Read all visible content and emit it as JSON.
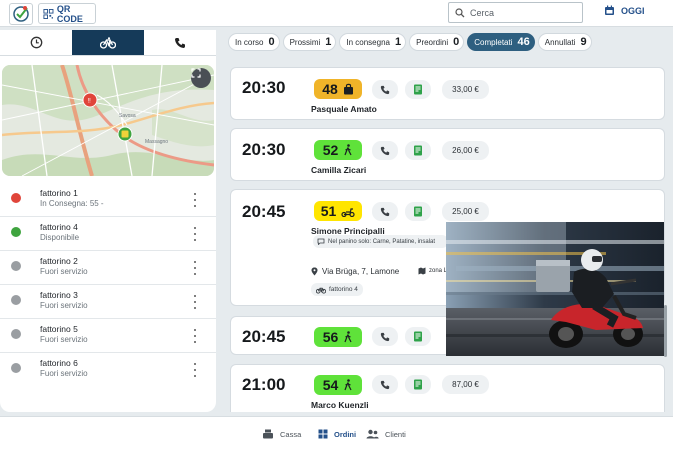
{
  "header": {
    "qr_label": "QR CODE",
    "search_placeholder": "Cerca",
    "today_label": "OGGI",
    "icons": [
      "app-logo-icon",
      "qr-icon",
      "search-icon",
      "calendar-icon"
    ]
  },
  "left_tabs": [
    {
      "icon": "clock-icon",
      "active": false
    },
    {
      "icon": "bicycle-icon",
      "active": true
    },
    {
      "icon": "phone-icon",
      "active": false
    }
  ],
  "couriers": [
    {
      "name": "fattorino 1",
      "status": "In Consegna: 55 -",
      "color": "#e0453a"
    },
    {
      "name": "fattorino 4",
      "status": "Disponibile",
      "color": "#3fa43f"
    },
    {
      "name": "fattorino 2",
      "status": "Fuori servizio",
      "color": "#9a9ea2"
    },
    {
      "name": "fattorino 3",
      "status": "Fuori servizio",
      "color": "#9a9ea2"
    },
    {
      "name": "fattorino 5",
      "status": "Fuori servizio",
      "color": "#9a9ea2"
    },
    {
      "name": "fattorino 6",
      "status": "Fuori servizio",
      "color": "#9a9ea2"
    }
  ],
  "filters": [
    {
      "label": "In corso",
      "count": "0",
      "active": false
    },
    {
      "label": "Prossimi",
      "count": "1",
      "active": false
    },
    {
      "label": "In consegna",
      "count": "1",
      "active": false
    },
    {
      "label": "Preordini",
      "count": "0",
      "active": false
    },
    {
      "label": "Completati",
      "count": "46",
      "active": true
    },
    {
      "label": "Annullati",
      "count": "9",
      "active": false
    }
  ],
  "orders": [
    {
      "time": "20:30",
      "number": "48",
      "badge_color": "#f0b429",
      "type_icon": "bag-icon",
      "price": "33,00 €",
      "customer": "Pasquale Amato"
    },
    {
      "time": "20:30",
      "number": "52",
      "badge_color": "#5fe23a",
      "type_icon": "walk-icon",
      "price": "26,00 €",
      "customer": "Camilla Zicari"
    },
    {
      "time": "20:45",
      "number": "51",
      "badge_color": "#ffe500",
      "type_icon": "scooter-icon",
      "price": "25,00 €",
      "customer": "Simone Principalli",
      "note": "Nel panino solo: Carne, Patatine, insalat",
      "address": "Via Brüga, 7, Lamone",
      "zone": "zona Lam",
      "rider": "fattorino 4"
    },
    {
      "time": "20:45",
      "number": "56",
      "badge_color": "#5fe23a",
      "type_icon": "walk-icon",
      "price": "",
      "customer": ""
    },
    {
      "time": "21:00",
      "number": "54",
      "badge_color": "#5fe23a",
      "type_icon": "walk-icon",
      "price": "87,00 €",
      "customer": "Marco Kuenzli"
    }
  ],
  "bottom_nav": [
    {
      "label": "Cassa",
      "icon": "register-icon",
      "active": false
    },
    {
      "label": "Ordini",
      "icon": "grid-icon",
      "active": true
    },
    {
      "label": "Clienti",
      "icon": "users-icon",
      "active": false
    }
  ]
}
